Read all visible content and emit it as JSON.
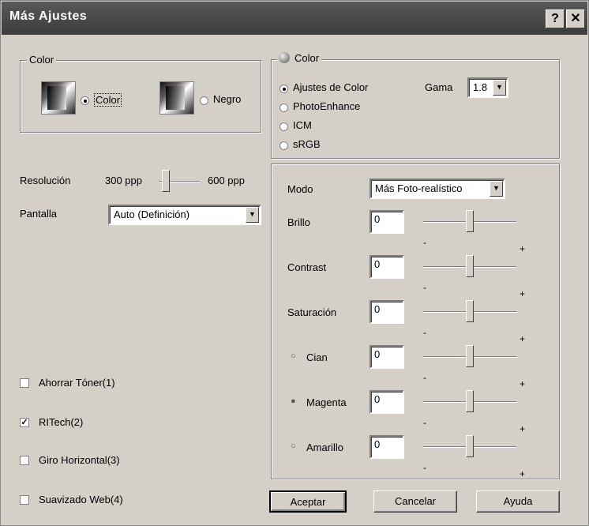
{
  "title": "Más Ajustes",
  "titlebar": {
    "help": "?",
    "close": "✕"
  },
  "left_color_group": {
    "legend": "Color",
    "options": [
      {
        "label": "Color",
        "selected": true
      },
      {
        "label": "Negro",
        "selected": false
      }
    ]
  },
  "resolution": {
    "label": "Resolución",
    "low": "300 ppp",
    "high": "600 ppp",
    "value_fraction": 0.1
  },
  "pantalla": {
    "label": "Pantalla",
    "value": "Auto (Definición)"
  },
  "checkboxes": [
    {
      "label": "Ahorrar Tóner(1)",
      "checked": false
    },
    {
      "label": "RITech(2)",
      "checked": true
    },
    {
      "label": "Giro Horizontal(3)",
      "checked": false
    },
    {
      "label": "Suavizado Web(4)",
      "checked": false
    }
  ],
  "right_color_group": {
    "legend": "Color",
    "options": [
      {
        "label": "Ajustes de Color",
        "selected": true
      },
      {
        "label": "PhotoEnhance",
        "selected": false
      },
      {
        "label": "ICM",
        "selected": false
      },
      {
        "label": "sRGB",
        "selected": false
      }
    ],
    "gama_label": "Gama",
    "gama_value": "1.8"
  },
  "modo": {
    "label": "Modo",
    "value": "Más Foto-realístico"
  },
  "adjustments": [
    {
      "label": "Brillo",
      "value": "0",
      "minus": "-",
      "plus": "+"
    },
    {
      "label": "Contrast",
      "value": "0",
      "minus": "-",
      "plus": "+"
    },
    {
      "label": "Saturación",
      "value": "0",
      "minus": "-",
      "plus": "+"
    },
    {
      "label": "Cian",
      "value": "0",
      "minus": "-",
      "plus": "+",
      "dot": "○"
    },
    {
      "label": "Magenta",
      "value": "0",
      "minus": "-",
      "plus": "+",
      "dot": "●"
    },
    {
      "label": "Amarillo",
      "value": "0",
      "minus": "-",
      "plus": "+",
      "dot": "○"
    }
  ],
  "buttons": {
    "ok": "Aceptar",
    "cancel": "Cancelar",
    "help": "Ayuda"
  }
}
